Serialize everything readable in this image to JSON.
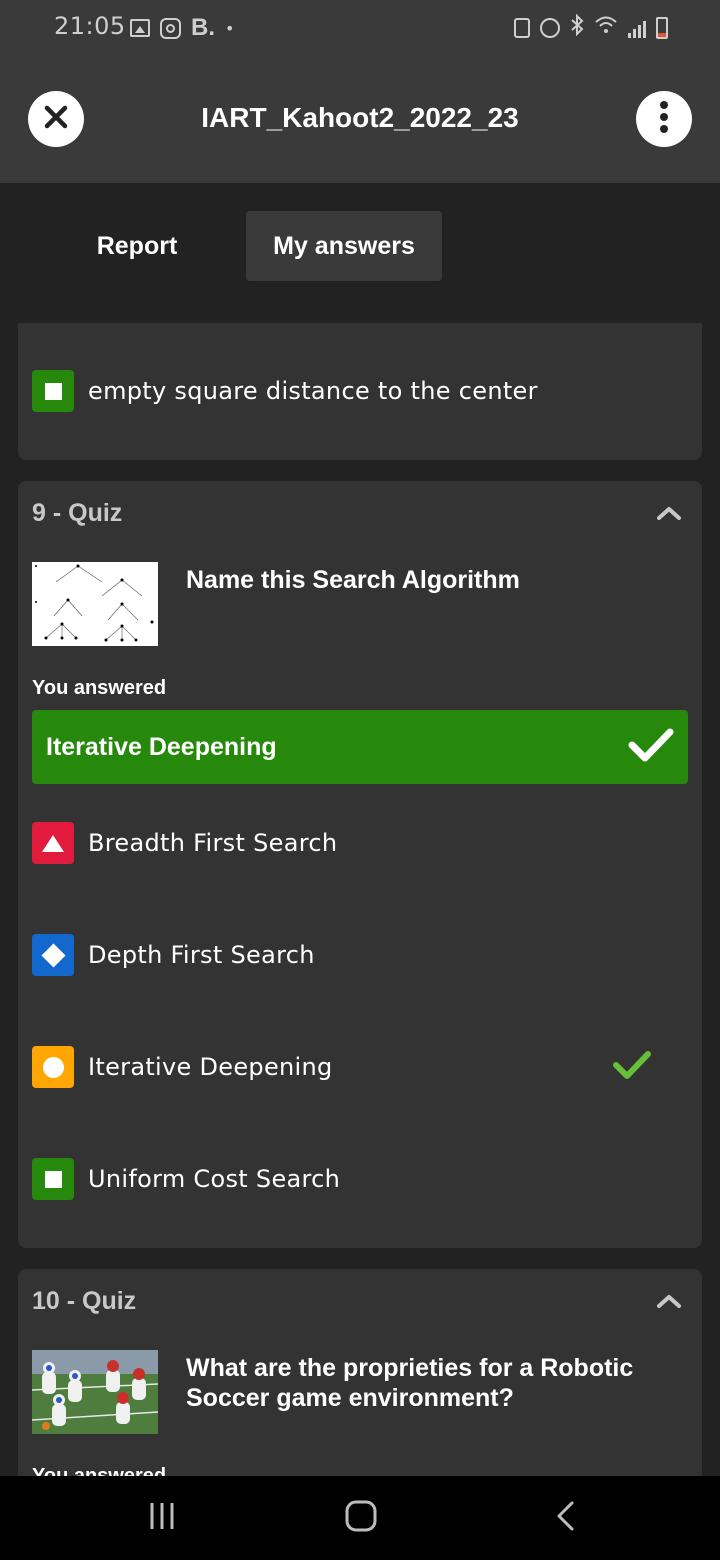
{
  "status_bar": {
    "time": "21:05",
    "brand_letter": "B.",
    "dot": "•",
    "left_icons": [
      "gallery-icon",
      "instagram-icon",
      "b-app-icon",
      "notification-dot"
    ],
    "right_icons": [
      "lock-icon",
      "alarm-icon",
      "bluetooth-icon",
      "wifi-icon",
      "signal-icon",
      "battery-low-icon"
    ]
  },
  "app_bar": {
    "title": "IART_Kahoot2_2022_23",
    "close_icon": "close-icon",
    "more_icon": "more-vertical-icon"
  },
  "tabs": [
    {
      "label": "Report",
      "selected": false
    },
    {
      "label": "My answers",
      "selected": true
    }
  ],
  "previous_card": {
    "answer": {
      "text": "empty square distance to the center",
      "shape": "square",
      "color": "#26890c"
    }
  },
  "questions": [
    {
      "header": "9 - Quiz",
      "question": "Name this Search Algorithm",
      "thumbnail": "search-tree-diagram-image",
      "you_answered_label": "You answered",
      "answered": {
        "text": "Iterative Deepening",
        "correct": true,
        "color": "#26890c"
      },
      "answers": [
        {
          "text": "Breadth First Search",
          "shape": "triangle",
          "color": "#e21b3c",
          "correct": false
        },
        {
          "text": "Depth First Search",
          "shape": "diamond",
          "color": "#1368ce",
          "correct": false
        },
        {
          "text": "Iterative Deepening",
          "shape": "circle",
          "color": "#ffa602",
          "correct": true
        },
        {
          "text": "Uniform Cost Search",
          "shape": "square",
          "color": "#26890c",
          "correct": false
        }
      ]
    },
    {
      "header": "10 - Quiz",
      "question": "What are the proprieties for a Robotic Soccer game environment?",
      "thumbnail": "robot-soccer-photo",
      "you_answered_label": "You answered"
    }
  ],
  "colors": {
    "background": "#222222",
    "card": "#333333",
    "header": "#3a3a3a",
    "correct_check": "#66bf39"
  },
  "nav_bar": {
    "icons": [
      "recent-apps-icon",
      "home-icon",
      "back-icon"
    ]
  }
}
